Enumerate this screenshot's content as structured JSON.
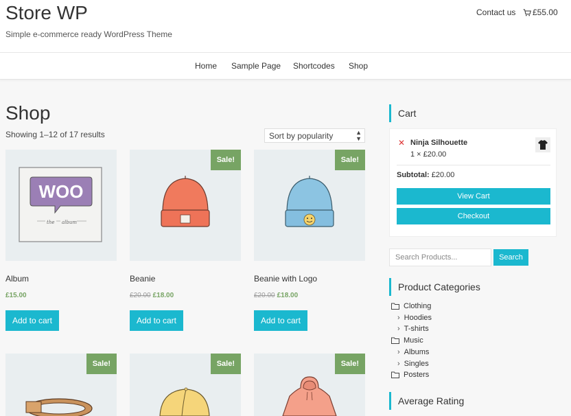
{
  "header": {
    "site_title": "Store WP",
    "tagline": "Simple e-commerce ready WordPress Theme",
    "contact_label": "Contact us",
    "cart_total": "£55.00"
  },
  "nav": {
    "items": [
      "Home",
      "Sample Page",
      "Shortcodes",
      "Shop"
    ]
  },
  "shop": {
    "title": "Shop",
    "result_count": "Showing 1–12 of 17 results",
    "sort_selected": "Sort by popularity",
    "sale_label": "Sale!",
    "add_to_cart_label": "Add to cart",
    "products": [
      {
        "name": "Album",
        "price": "£15.00",
        "old_price": "",
        "sale": false,
        "image": "woo-album"
      },
      {
        "name": "Beanie",
        "price": "£18.00",
        "old_price": "£20.00",
        "sale": true,
        "image": "beanie-orange"
      },
      {
        "name": "Beanie with Logo",
        "price": "£18.00",
        "old_price": "£20.00",
        "sale": true,
        "image": "beanie-blue"
      },
      {
        "name": "",
        "price": "",
        "old_price": "",
        "sale": true,
        "image": "belt"
      },
      {
        "name": "",
        "price": "",
        "old_price": "",
        "sale": true,
        "image": "cap"
      },
      {
        "name": "",
        "price": "",
        "old_price": "",
        "sale": true,
        "image": "hoodie"
      }
    ]
  },
  "sidebar": {
    "cart_title": "Cart",
    "cart_item": {
      "name": "Ninja Silhouette",
      "qty_price": "1 × £20.00"
    },
    "subtotal_label": "Subtotal:",
    "subtotal_value": "£20.00",
    "view_cart_label": "View Cart",
    "checkout_label": "Checkout",
    "search_placeholder": "Search Products...",
    "search_button": "Search",
    "categories_title": "Product Categories",
    "categories": [
      {
        "label": "Clothing",
        "level": 0
      },
      {
        "label": "Hoodies",
        "level": 1
      },
      {
        "label": "T-shirts",
        "level": 1
      },
      {
        "label": "Music",
        "level": 0
      },
      {
        "label": "Albums",
        "level": 1
      },
      {
        "label": "Singles",
        "level": 1
      },
      {
        "label": "Posters",
        "level": 0
      }
    ],
    "rating_title": "Average Rating"
  },
  "colors": {
    "accent": "#1bb8cf",
    "sale": "#77a464"
  }
}
